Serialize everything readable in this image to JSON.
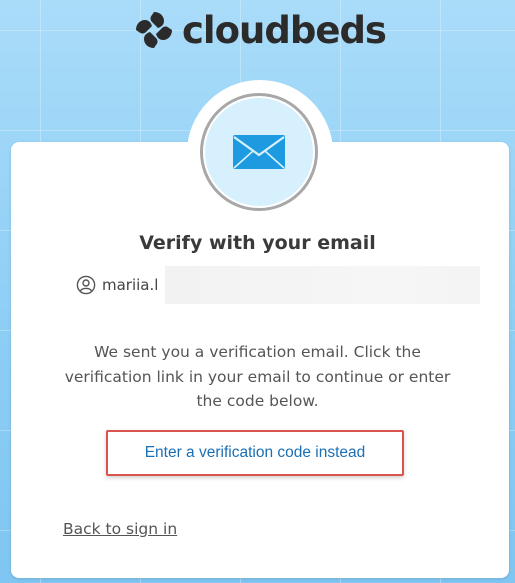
{
  "brand": {
    "name": "cloudbeds",
    "logo_icon": "cloudbeds-logo-icon",
    "text_color": "#2b2b2b"
  },
  "badge": {
    "icon": "envelope-icon",
    "icon_color": "#1e9ae0",
    "background": "#d6f0fd"
  },
  "card": {
    "title": "Verify with your email",
    "user": {
      "icon": "user-circle-icon",
      "username": "mariia.l"
    },
    "description": "We sent you a verification email. Click the verification link in your email to continue or enter the code below.",
    "code_link_label": "Enter a verification code instead",
    "back_link_label": "Back to sign in"
  },
  "colors": {
    "link": "#1a6fb6",
    "highlight_border": "#d9534f",
    "background": "#8fd0f6"
  }
}
